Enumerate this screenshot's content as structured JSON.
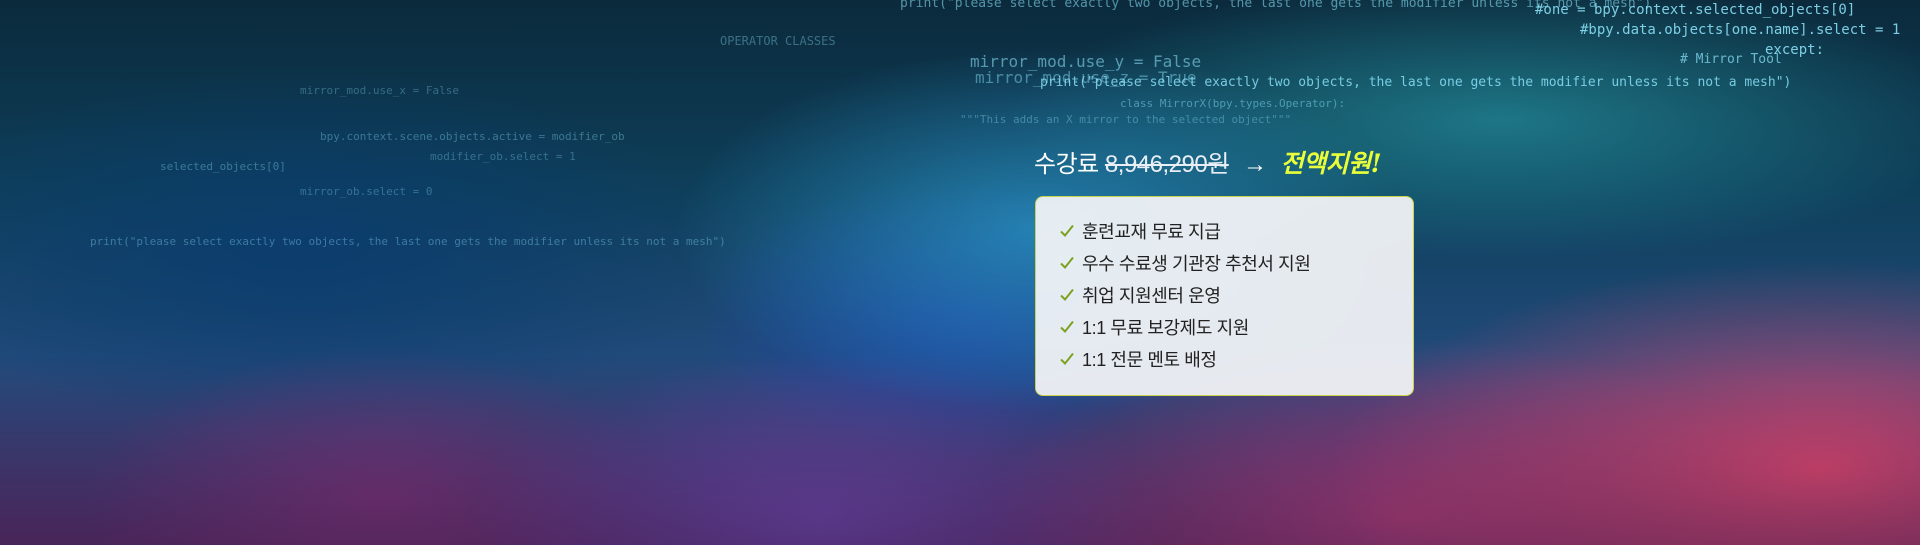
{
  "banner": {
    "code_lines": [
      "print(\"please select exactly two objects, the last one gets the modifier unless its not a mesh\")",
      "#one = bpy.context.selected_objects[0]",
      "#bpy.data.objects[one.name].select = 1",
      "mirror_mod.use_y = False",
      "mirror_mod.use_z = True",
      "OPERATOR CLASSES",
      "except:",
      "# Mirror Tool",
      "print(\"please select exactly two objects, the last one gets the modifier unless its not a mesh\")",
      "class MirrorX(bpy.types.Operator):",
      "\"\"\"This adds an X mirror to the selected object\"\"\"",
      "mirror_mod.use_x = False",
      "bpy.context.scene.objects.active = modifier_ob",
      "modifier_ob.select = 1",
      "selected_objects[0]",
      "mirror_ob.select = 0",
      "print(\"please select exactly two objects, the last one gets the modifier unless its not a mesh\")"
    ]
  },
  "offer": {
    "label": "수강료",
    "price": "8,946,290원",
    "arrow": "→",
    "support": "전액지원!"
  },
  "benefits": {
    "items": [
      "훈련교재 무료 지급",
      "우수 수료생 기관장 추천서 지원",
      "취업 지원센터 운영",
      "1:1 무료 보강제도 지원",
      "1:1 전문 멘토 배정"
    ]
  },
  "colors": {
    "accent_yellow": "#e9ff3a",
    "check_green": "#7ea21e",
    "card_border": "#c9d44a"
  }
}
